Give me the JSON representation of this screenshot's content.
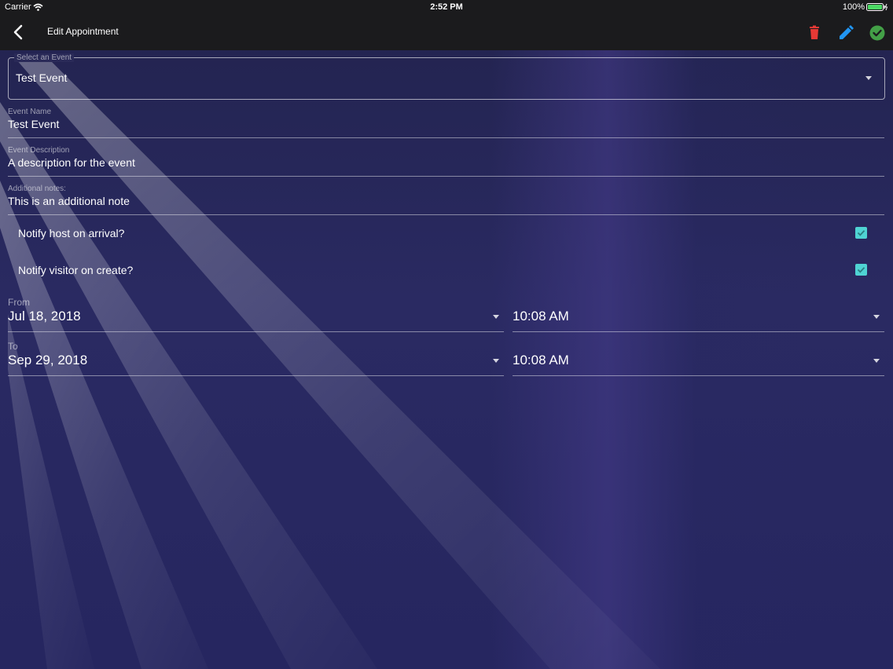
{
  "status_bar": {
    "carrier": "Carrier",
    "time": "2:52 PM",
    "battery": "100%"
  },
  "app_bar": {
    "title": "Edit Appointment",
    "icons": [
      "back-chevron-icon",
      "trash-icon",
      "pencil-icon",
      "check-circle-icon"
    ],
    "colors": {
      "delete": "#e53935",
      "edit": "#2196f3",
      "save": "#43a047"
    }
  },
  "form": {
    "event_select": {
      "label": "Select an Event",
      "value": "Test Event"
    },
    "event_name": {
      "label": "Event Name",
      "value": "Test Event"
    },
    "event_description": {
      "label": "Event Description",
      "value": "A description for the event"
    },
    "additional_notes": {
      "label": "Additional notes:",
      "value": "This is an additional note"
    },
    "notify_host": {
      "label": "Notify host on arrival?",
      "checked": true
    },
    "notify_visitor": {
      "label": "Notify visitor on create?",
      "checked": true
    },
    "from": {
      "label": "From",
      "date": "Jul 18, 2018",
      "time": "10:08 AM"
    },
    "to": {
      "label": "To",
      "date": "Sep 29, 2018",
      "time": "10:08 AM"
    }
  },
  "theme": {
    "accent_checkbox": "#4fd3d3",
    "background": "#24244f"
  }
}
